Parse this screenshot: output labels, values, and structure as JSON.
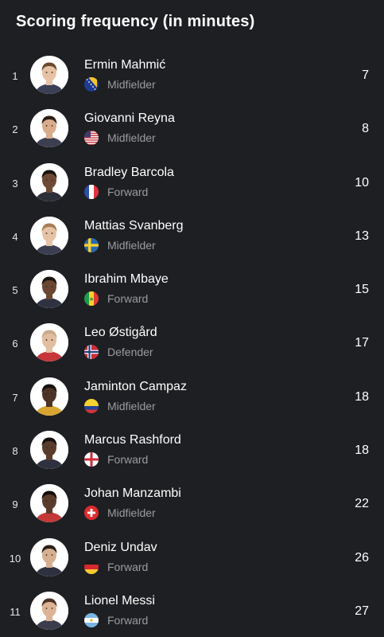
{
  "header": {
    "title": "Scoring frequency (in minutes)"
  },
  "players": [
    {
      "rank": "1",
      "name": "Ermin Mahmić",
      "position": "Midfielder",
      "value": "7",
      "flag": "bosnia-flag",
      "skin": "#e7c2a4",
      "hair": "#6b4a2c",
      "shirt": "#3a3f56"
    },
    {
      "rank": "2",
      "name": "Giovanni Reyna",
      "position": "Midfielder",
      "value": "8",
      "flag": "usa-flag",
      "skin": "#d9ac8c",
      "hair": "#2a1d16",
      "shirt": "#3c3f52"
    },
    {
      "rank": "3",
      "name": "Bradley Barcola",
      "position": "Forward",
      "value": "10",
      "flag": "france-flag",
      "skin": "#6e4a34",
      "hair": "#1a1411",
      "shirt": "#2c2e38"
    },
    {
      "rank": "4",
      "name": "Mattias Svanberg",
      "position": "Midfielder",
      "value": "13",
      "flag": "sweden-flag",
      "skin": "#e6c3a6",
      "hair": "#a77d52",
      "shirt": "#3b3e52"
    },
    {
      "rank": "5",
      "name": "Ibrahim Mbaye",
      "position": "Forward",
      "value": "15",
      "flag": "senegal-flag",
      "skin": "#6a4633",
      "hair": "#1b1410",
      "shirt": "#2f3242"
    },
    {
      "rank": "6",
      "name": "Leo Østigård",
      "position": "Defender",
      "value": "17",
      "flag": "norway-flag",
      "skin": "#e2bd9f",
      "hair": "#c9ab8c",
      "shirt": "#c6363b"
    },
    {
      "rank": "7",
      "name": "Jaminton Campaz",
      "position": "Midfielder",
      "value": "18",
      "flag": "colombia-flag",
      "skin": "#4c3326",
      "hair": "#140f0c",
      "shirt": "#d9a531"
    },
    {
      "rank": "8",
      "name": "Marcus Rashford",
      "position": "Forward",
      "value": "18",
      "flag": "england-flag",
      "skin": "#5a3c2d",
      "hair": "#15100d",
      "shirt": "#2e3140"
    },
    {
      "rank": "9",
      "name": "Johan Manzambi",
      "position": "Midfielder",
      "value": "22",
      "flag": "switzerland-flag",
      "skin": "#5b3b2b",
      "hair": "#130e0b",
      "shirt": "#c43837"
    },
    {
      "rank": "10",
      "name": "Deniz Undav",
      "position": "Forward",
      "value": "26",
      "flag": "germany-flag",
      "skin": "#d6ae90",
      "hair": "#2a1f19",
      "shirt": "#2f3140"
    },
    {
      "rank": "11",
      "name": "Lionel Messi",
      "position": "Forward",
      "value": "27",
      "flag": "argentina-flag",
      "skin": "#dcb394",
      "hair": "#4a3426",
      "shirt": "#3b3c4c"
    }
  ]
}
